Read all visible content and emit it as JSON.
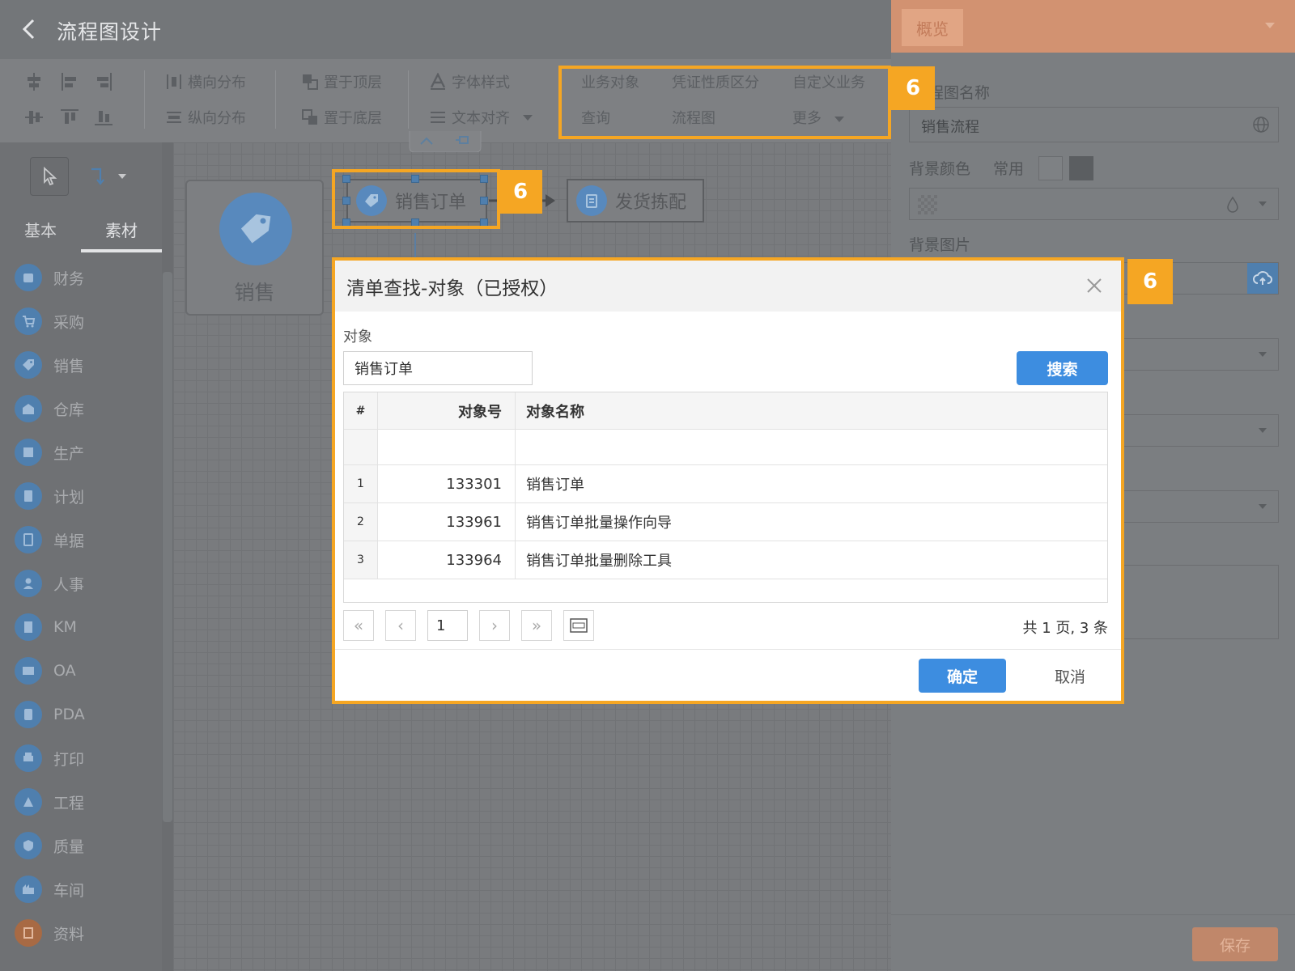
{
  "header": {
    "title": "流程图设计"
  },
  "toolbar": {
    "h_distribute": "横向分布",
    "v_distribute": "纵向分布",
    "bring_front": "置于顶层",
    "send_back": "置于底层",
    "font_style": "字体样式",
    "text_align": "文本对齐",
    "business": {
      "obj": "业务对象",
      "voucher": "凭证性质区分",
      "custom": "自定义业务",
      "query": "查询",
      "flowchart": "流程图",
      "more": "更多"
    }
  },
  "sidebar": {
    "tabs": [
      "基本",
      "素材"
    ],
    "categories": [
      "财务",
      "采购",
      "销售",
      "仓库",
      "生产",
      "计划",
      "单据",
      "人事",
      "KM",
      "OA",
      "PDA",
      "打印",
      "工程",
      "质量",
      "车间",
      "资料"
    ]
  },
  "canvas": {
    "group_label": "销售",
    "node_sales_order": "销售订单",
    "node_shipping": "发货拣配"
  },
  "right_panel": {
    "tab": "概览",
    "flow_name_label": "程图名称",
    "flow_name_value": "销售流程",
    "bg_color_label": "背景颜色",
    "common_label": "常用",
    "bg_image_label": "背景图片",
    "save": "保存"
  },
  "dialog": {
    "title": "清单查找-对象（已授权）",
    "object_label": "对象",
    "object_value": "销售订单",
    "search_button": "搜索",
    "columns": {
      "idx": "#",
      "code": "对象号",
      "name": "对象名称"
    },
    "rows": [
      {
        "idx": "1",
        "code": "133301",
        "name": "销售订单"
      },
      {
        "idx": "2",
        "code": "133961",
        "name": "销售订单批量操作向导"
      },
      {
        "idx": "3",
        "code": "133964",
        "name": "销售订单批量删除工具"
      }
    ],
    "page": "1",
    "summary": "共 1 页, 3 条",
    "ok": "确定",
    "cancel": "取消"
  },
  "badges": {
    "b1": "6",
    "b2": "6",
    "b3": "6"
  },
  "colors": {
    "highlight": "#f5a623",
    "primary": "#3d8de0",
    "panel_accent": "#d29271"
  }
}
